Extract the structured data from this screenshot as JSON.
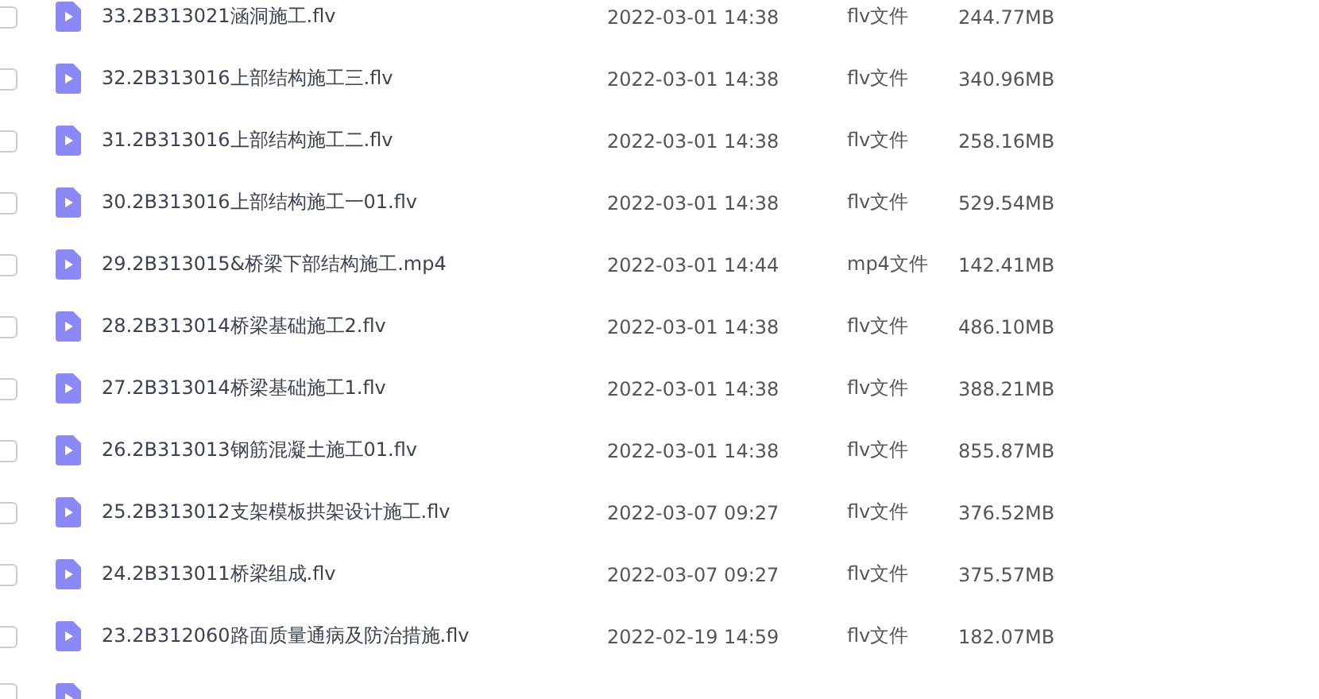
{
  "files": [
    {
      "name": "33.2B313021涵洞施工.flv",
      "modified": "2022-03-01 14:38",
      "type": "flv文件",
      "size": "244.77MB",
      "checked": false
    },
    {
      "name": "32.2B313016上部结构施工三.flv",
      "modified": "2022-03-01 14:38",
      "type": "flv文件",
      "size": "340.96MB",
      "checked": false
    },
    {
      "name": "31.2B313016上部结构施工二.flv",
      "modified": "2022-03-01 14:38",
      "type": "flv文件",
      "size": "258.16MB",
      "checked": false
    },
    {
      "name": "30.2B313016上部结构施工一01.flv",
      "modified": "2022-03-01 14:38",
      "type": "flv文件",
      "size": "529.54MB",
      "checked": false
    },
    {
      "name": "29.2B313015&桥梁下部结构施工.mp4",
      "modified": "2022-03-01 14:44",
      "type": "mp4文件",
      "size": "142.41MB",
      "checked": false
    },
    {
      "name": "28.2B313014桥梁基础施工2.flv",
      "modified": "2022-03-01 14:38",
      "type": "flv文件",
      "size": "486.10MB",
      "checked": false
    },
    {
      "name": "27.2B313014桥梁基础施工1.flv",
      "modified": "2022-03-01 14:38",
      "type": "flv文件",
      "size": "388.21MB",
      "checked": false
    },
    {
      "name": "26.2B313013钢筋混凝土施工01.flv",
      "modified": "2022-03-01 14:38",
      "type": "flv文件",
      "size": "855.87MB",
      "checked": false
    },
    {
      "name": "25.2B313012支架模板拱架设计施工.flv",
      "modified": "2022-03-07 09:27",
      "type": "flv文件",
      "size": "376.52MB",
      "checked": false
    },
    {
      "name": "24.2B313011桥梁组成.flv",
      "modified": "2022-03-07 09:27",
      "type": "flv文件",
      "size": "375.57MB",
      "checked": false
    },
    {
      "name": "23.2B312060路面质量通病及防治措施.flv",
      "modified": "2022-02-19 14:59",
      "type": "flv文件",
      "size": "182.07MB",
      "checked": false
    },
    {
      "checked": false
    }
  ]
}
